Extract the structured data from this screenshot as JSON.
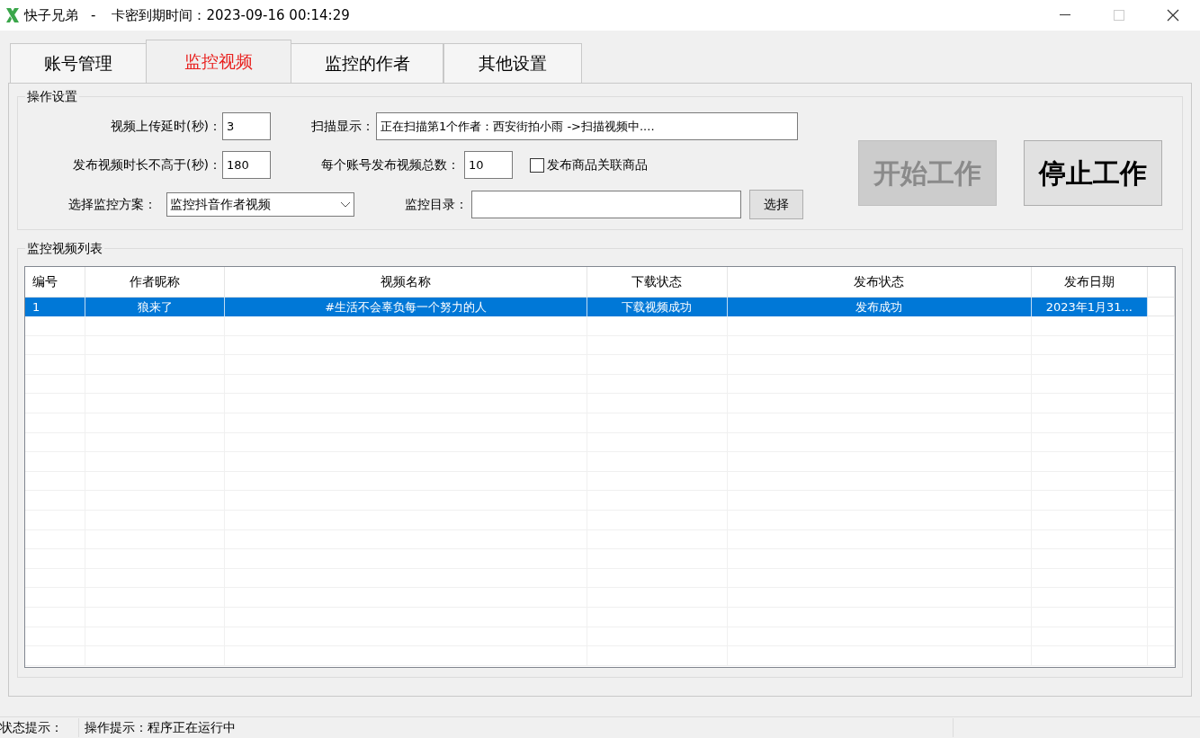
{
  "window": {
    "app_name": "快子兄弟",
    "separator": "-",
    "expiry": "卡密到期时间：2023-09-16 00:14:29"
  },
  "tabs": [
    {
      "label": "账号管理",
      "selected": false
    },
    {
      "label": "监控视频",
      "selected": true
    },
    {
      "label": "监控的作者",
      "selected": false
    },
    {
      "label": "其他设置",
      "selected": false
    }
  ],
  "settings": {
    "title": "操作设置",
    "upload_delay": {
      "label": "视频上传延时(秒)：",
      "value": "3"
    },
    "scan_display": {
      "label": "扫描显示：",
      "value": "正在扫描第1个作者：西安街拍小雨 ->扫描视频中...."
    },
    "max_duration": {
      "label": "发布视频时长不高于(秒)：",
      "value": "180"
    },
    "total_per_account": {
      "label": "每个账号发布视频总数：",
      "value": "10"
    },
    "link_goods": {
      "label": "发布商品关联商品",
      "checked": false
    },
    "scheme": {
      "label": "选择监控方案：",
      "value": "监控抖音作者视频"
    },
    "directory": {
      "label": "监控目录：",
      "button": "选择"
    },
    "start_button": {
      "label": "开始工作",
      "disabled": true
    },
    "stop_button": {
      "label": "停止工作",
      "disabled": false
    }
  },
  "video_list": {
    "title": "监控视频列表",
    "columns": [
      "编号",
      "作者昵称",
      "视频名称",
      "下载状态",
      "发布状态",
      "发布日期"
    ],
    "rows": [
      {
        "cells": [
          "1",
          "狼来了",
          "#生活不会辜负每一个努力的人",
          "下载视频成功",
          "发布成功",
          "2023年1月31..."
        ],
        "selected": true
      }
    ]
  },
  "status_bar": {
    "label": "状态提示：",
    "message": "操作提示：程序正在运行中"
  }
}
